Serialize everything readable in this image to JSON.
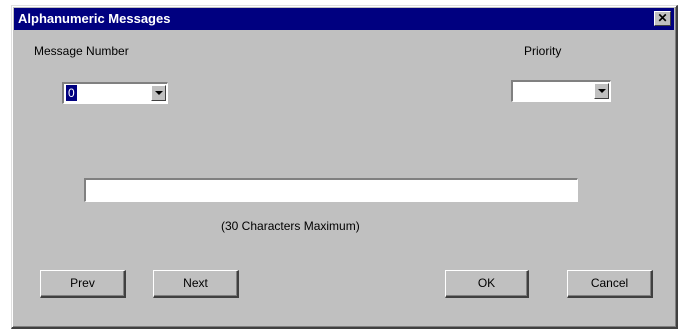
{
  "window": {
    "title": "Alphanumeric Messages",
    "close_glyph": "✕"
  },
  "message_number": {
    "label": "Message Number",
    "value": "0"
  },
  "priority": {
    "label": "Priority",
    "value": ""
  },
  "message_field": {
    "value": "",
    "hint": "(30 Characters Maximum)"
  },
  "buttons": {
    "prev": "Prev",
    "next": "Next",
    "ok": "OK",
    "cancel": "Cancel"
  },
  "colors": {
    "titlebar": "#000080",
    "face": "#c0c0c0"
  },
  "icons": {
    "close": "close-icon",
    "dropdown": "chevron-down-icon"
  }
}
